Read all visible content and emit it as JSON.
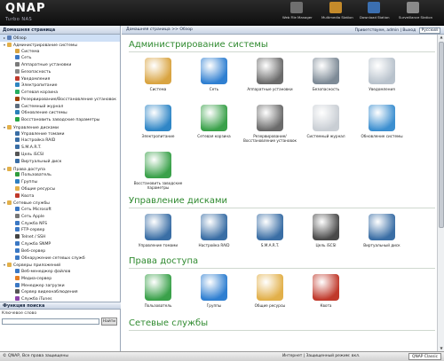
{
  "header": {
    "logo": "QNAP",
    "sublogo": "Turbo NAS",
    "icons": [
      {
        "label": "Web File Manager",
        "icon": "web-file-manager-icon",
        "color": "#6f6f6f"
      },
      {
        "label": "Multimedia Station",
        "icon": "multimedia-station-icon",
        "color": "#c48a2a"
      },
      {
        "label": "Download Station",
        "icon": "download-station-icon",
        "color": "#3b6fb0"
      },
      {
        "label": "Surveillance Station",
        "icon": "surveillance-station-icon",
        "color": "#8a8a8a"
      }
    ]
  },
  "sidebar": {
    "title": "Домашняя страница",
    "tree": [
      {
        "label": "Обзор",
        "level": 0,
        "selected": true,
        "icon": "overview-icon",
        "color": "#5a7fb8"
      },
      {
        "label": "Администрирование системы",
        "level": 0,
        "expanded": true,
        "icon": "folder-icon",
        "color": "#e2b04a"
      },
      {
        "label": "Система",
        "level": 1,
        "icon": "system-icon",
        "color": "#d9a441"
      },
      {
        "label": "Сеть",
        "level": 1,
        "icon": "network-icon",
        "color": "#3b78c4"
      },
      {
        "label": "Аппаратные установки",
        "level": 1,
        "icon": "hardware-icon",
        "color": "#7a7a7a"
      },
      {
        "label": "Безопасность",
        "level": 1,
        "icon": "security-icon",
        "color": "#888"
      },
      {
        "label": "Уведомления",
        "level": 1,
        "icon": "notifications-icon",
        "color": "#c0392b"
      },
      {
        "label": "Электропитание",
        "level": 1,
        "icon": "power-icon",
        "color": "#2e86c1"
      },
      {
        "label": "Сетевая корзина",
        "level": 1,
        "icon": "recycle-bin-icon",
        "color": "#27ae60"
      },
      {
        "label": "Резервирование/Восстановление установок",
        "level": 1,
        "icon": "backup-icon",
        "color": "#a04000"
      },
      {
        "label": "Системный журнал",
        "level": 1,
        "icon": "system-log-icon",
        "color": "#5d6d7e"
      },
      {
        "label": "Обновление системы",
        "level": 1,
        "icon": "firmware-update-icon",
        "color": "#2980b9"
      },
      {
        "label": "Восстановить заводские параметры",
        "level": 1,
        "icon": "factory-reset-icon",
        "color": "#28a745"
      },
      {
        "label": "Управление дисками",
        "level": 0,
        "expanded": true,
        "icon": "folder-icon",
        "color": "#e2b04a"
      },
      {
        "label": "Управление томами",
        "level": 1,
        "icon": "volume-icon",
        "color": "#3a6ea5"
      },
      {
        "label": "Настройка RAID",
        "level": 1,
        "icon": "raid-icon",
        "color": "#3a6ea5"
      },
      {
        "label": "S.M.A.R.T.",
        "level": 1,
        "icon": "smart-icon",
        "color": "#3a6ea5"
      },
      {
        "label": "Цель iSCSI",
        "level": 1,
        "icon": "iscsi-icon",
        "color": "#555"
      },
      {
        "label": "Виртуальный диск",
        "level": 1,
        "icon": "virtual-disk-icon",
        "color": "#3a6ea5"
      },
      {
        "label": "Права доступа",
        "level": 0,
        "expanded": true,
        "icon": "folder-icon",
        "color": "#e2b04a"
      },
      {
        "label": "Пользователь",
        "level": 1,
        "icon": "user-icon",
        "color": "#2e9c3c"
      },
      {
        "label": "Группы",
        "level": 1,
        "icon": "groups-icon",
        "color": "#2e7fc1"
      },
      {
        "label": "Общие ресурсы",
        "level": 1,
        "icon": "shared-folder-icon",
        "color": "#e2b04a"
      },
      {
        "label": "Квота",
        "level": 1,
        "icon": "quota-icon",
        "color": "#c0392b"
      },
      {
        "label": "Сетевые службы",
        "level": 0,
        "expanded": true,
        "icon": "folder-icon",
        "color": "#e2b04a"
      },
      {
        "label": "Сеть Microsoft",
        "level": 1,
        "icon": "microsoft-icon",
        "color": "#3b78c4"
      },
      {
        "label": "Сеть Apple",
        "level": 1,
        "icon": "apple-icon",
        "color": "#777"
      },
      {
        "label": "Служба NFS",
        "level": 1,
        "icon": "nfs-icon",
        "color": "#3b78c4"
      },
      {
        "label": "FTP-сервер",
        "level": 1,
        "icon": "ftp-icon",
        "color": "#3b78c4"
      },
      {
        "label": "Telnet / SSH",
        "level": 1,
        "icon": "telnet-icon",
        "color": "#444"
      },
      {
        "label": "Служба SNMP",
        "level": 1,
        "icon": "snmp-icon",
        "color": "#3b78c4"
      },
      {
        "label": "Веб-сервер",
        "level": 1,
        "icon": "web-server-icon",
        "color": "#3b78c4"
      },
      {
        "label": "Обнаружение сетевых служб",
        "level": 1,
        "icon": "discovery-icon",
        "color": "#3b78c4"
      },
      {
        "label": "Серверы приложений",
        "level": 0,
        "expanded": true,
        "icon": "folder-icon",
        "color": "#e2b04a"
      },
      {
        "label": "Веб-менеджер файлов",
        "level": 1,
        "icon": "web-file-icon",
        "color": "#3b78c4"
      },
      {
        "label": "Медиа-сервер",
        "level": 1,
        "icon": "media-server-icon",
        "color": "#e67e22"
      },
      {
        "label": "Менеджер загрузки",
        "level": 1,
        "icon": "download-icon",
        "color": "#3b78c4"
      },
      {
        "label": "Сервер видеонаблюдения",
        "level": 1,
        "icon": "camera-icon",
        "color": "#555"
      },
      {
        "label": "Служба iTunes",
        "level": 1,
        "icon": "itunes-icon",
        "color": "#8e44ad"
      }
    ],
    "search_title": "Функция поиска",
    "keyword_label": "Ключевое слово",
    "keyword_value": "",
    "search_button": "Найти"
  },
  "topbar": {
    "breadcrumb": "Домашняя страница >> Обзор",
    "welcome": "Приветствуем, admin | Выход",
    "language": "Русский"
  },
  "main": {
    "sections": [
      {
        "title": "Администрирование системы",
        "items": [
          {
            "label": "Система",
            "icon": "system-icon",
            "color": "#d9a441"
          },
          {
            "label": "Сеть",
            "icon": "network-globe-icon",
            "color": "#2f7fd1"
          },
          {
            "label": "Аппаратные установки",
            "icon": "hardware-icon",
            "color": "#6b6b6b"
          },
          {
            "label": "Безопасность",
            "icon": "security-icon",
            "color": "#7d8a96"
          },
          {
            "label": "Уведомления",
            "icon": "notifications-icon",
            "color": "#b8c2cc"
          },
          {
            "label": "Электропитание",
            "icon": "power-icon",
            "color": "#2f86c6"
          },
          {
            "label": "Сетевая корзина",
            "icon": "recycle-bin-icon",
            "color": "#3aa14a"
          },
          {
            "label": "Резервирование/Восстановление установок",
            "icon": "backup-icon",
            "color": "#6b6b6b"
          },
          {
            "label": "Системный журнал",
            "icon": "system-log-icon",
            "color": "#c9ced4"
          },
          {
            "label": "Обновление системы",
            "icon": "firmware-update-icon",
            "color": "#3c8fd0"
          },
          {
            "label": "Восстановить заводские параметры",
            "icon": "factory-reset-icon",
            "color": "#3aa14a"
          }
        ]
      },
      {
        "title": "Управление дисками",
        "items": [
          {
            "label": "Управление томами",
            "icon": "volume-icon",
            "color": "#3a6ea5"
          },
          {
            "label": "Настройка RAID",
            "icon": "raid-icon",
            "color": "#3a6ea5"
          },
          {
            "label": "S.M.A.R.T.",
            "icon": "smart-icon",
            "color": "#3a6ea5"
          },
          {
            "label": "Цель iSCSI",
            "icon": "iscsi-icon",
            "color": "#4a4a4a"
          },
          {
            "label": "Виртуальный диск",
            "icon": "virtual-disk-icon",
            "color": "#3a6ea5"
          }
        ]
      },
      {
        "title": "Права доступа",
        "items": [
          {
            "label": "Пользователь",
            "icon": "user-icon",
            "color": "#3aa14a"
          },
          {
            "label": "Группы",
            "icon": "groups-icon",
            "color": "#2f7fd1"
          },
          {
            "label": "Общие ресурсы",
            "icon": "shared-folder-icon",
            "color": "#e2b04a"
          },
          {
            "label": "Квота",
            "icon": "quota-icon",
            "color": "#c0392b"
          }
        ]
      },
      {
        "title": "Сетевые службы",
        "items": []
      }
    ]
  },
  "statusbar": {
    "copyright": "© QNAP, Все права защищены",
    "zone": "Интернет | Защищенный режим: вкл.",
    "brand": "QNAP Classic"
  }
}
